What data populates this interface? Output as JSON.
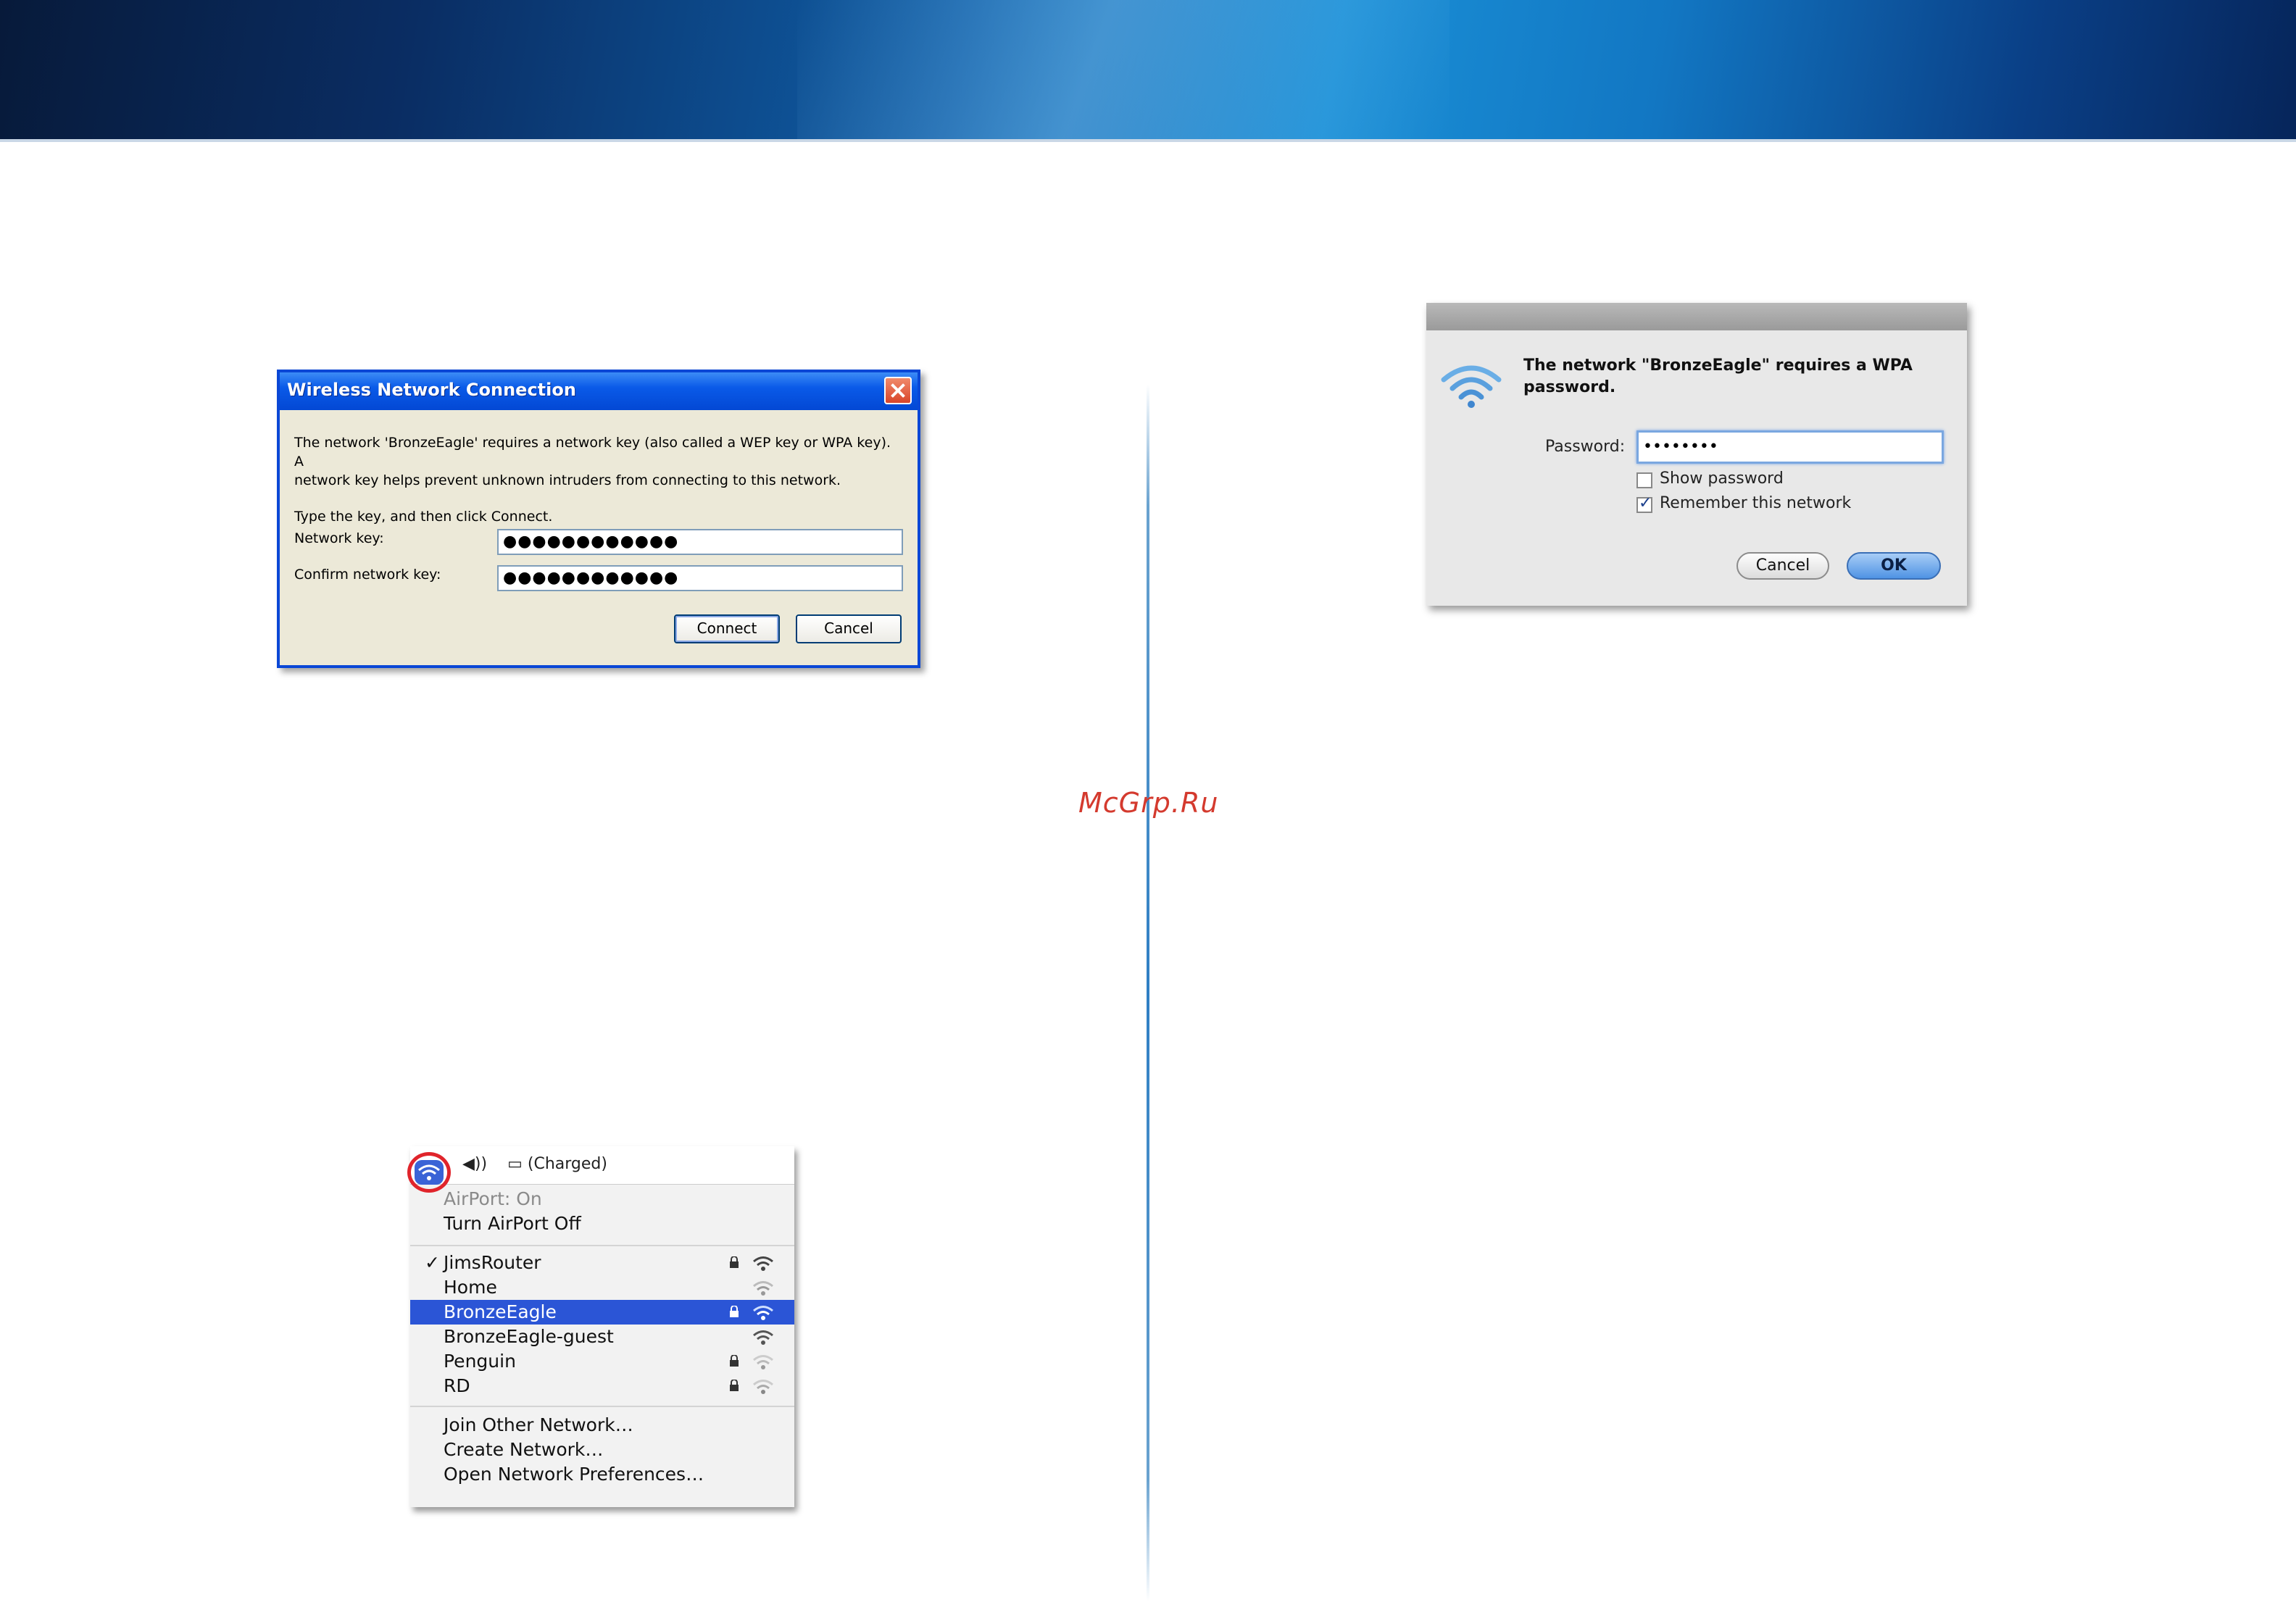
{
  "watermark": "McGrp.Ru",
  "xp_dialog": {
    "title": "Wireless Network Connection",
    "message_line1": "The network 'BronzeEagle' requires a network key (also called a WEP key or WPA key). A",
    "message_line2": "network key helps prevent unknown intruders from connecting to this network.",
    "instruction": "Type the key, and then click Connect.",
    "network_key_label": "Network key:",
    "network_key_value": "●●●●●●●●●●●●",
    "confirm_key_label": "Confirm network key:",
    "confirm_key_value": "●●●●●●●●●●●●",
    "connect_label": "Connect",
    "cancel_label": "Cancel"
  },
  "mac_sheet": {
    "message_line1": "The network \"BronzeEagle\" requires a WPA",
    "message_line2": "password.",
    "password_label": "Password:",
    "password_value": "••••••••",
    "show_password_label": "Show password",
    "show_password_checked": false,
    "remember_label": "Remember this network",
    "remember_checked": true,
    "cancel_label": "Cancel",
    "ok_label": "OK"
  },
  "airport_menu": {
    "menubar_status": "(Charged)",
    "airport_status": "AirPort: On",
    "turn_off": "Turn AirPort Off",
    "networks": [
      {
        "name": "JimsRouter",
        "checked": true,
        "locked": true
      },
      {
        "name": "Home",
        "checked": false,
        "locked": false
      },
      {
        "name": "BronzeEagle",
        "checked": false,
        "locked": true,
        "selected": true
      },
      {
        "name": "BronzeEagle-guest",
        "checked": false,
        "locked": false
      },
      {
        "name": "Penguin",
        "checked": false,
        "locked": true
      },
      {
        "name": "RD",
        "checked": false,
        "locked": true
      }
    ],
    "join_other": "Join Other Network…",
    "create": "Create Network…",
    "open_prefs": "Open Network Preferences…"
  },
  "colors": {
    "xp_title": "#0a5ae8",
    "menu_selected": "#2b55d6",
    "airport_highlight": "#e0242b",
    "watermark": "#d43a2e"
  }
}
